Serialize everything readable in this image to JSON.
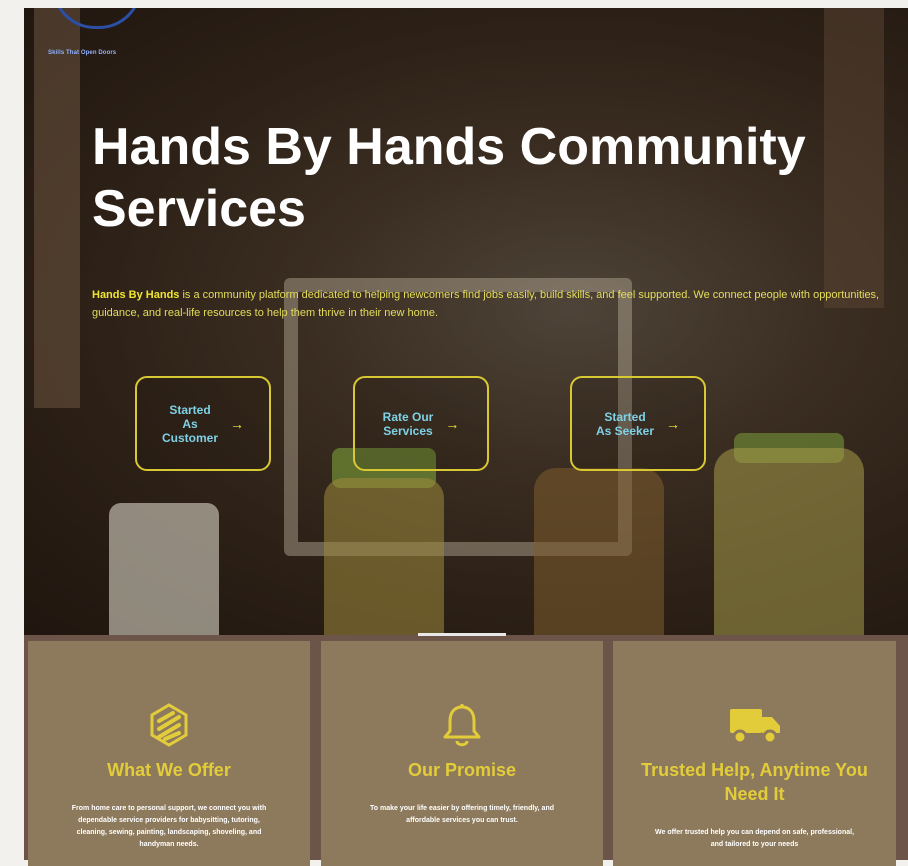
{
  "brand": {
    "tagline": "Skills That Open Doors"
  },
  "hero": {
    "title": "Hands By Hands Community Services",
    "description_strong": "Hands By Hands",
    "description_rest": " is a community platform dedicated to helping newcomers find jobs easily, build skills, and feel supported. We connect people with opportunities, guidance, and real-life resources to help them thrive in their new home."
  },
  "cta": [
    {
      "label": "Started\nAs\nCustomer",
      "arrow": "→"
    },
    {
      "label": "Rate Our\nServices",
      "arrow": "→"
    },
    {
      "label": "Started\nAs Seeker",
      "arrow": "→"
    }
  ],
  "features": [
    {
      "icon": "layers-logo-icon",
      "title": "What We Offer",
      "text": "From home care to personal support, we connect you with dependable service providers for babysitting, tutoring, cleaning, sewing, painting, landscaping, shoveling, and handyman needs."
    },
    {
      "icon": "bell-icon",
      "title": "Our Promise",
      "text": "To make your life easier by offering timely, friendly, and affordable services you can trust."
    },
    {
      "icon": "truck-icon",
      "title": "Trusted Help, Anytime You Need It",
      "text": "We offer trusted help you can depend on safe, professional, and tailored to your needs"
    }
  ],
  "colors": {
    "accent_yellow": "#e2cc3a",
    "button_text": "#7fd1e6",
    "card_bg": "#8d7a5d",
    "section_bg": "#6c5448"
  }
}
